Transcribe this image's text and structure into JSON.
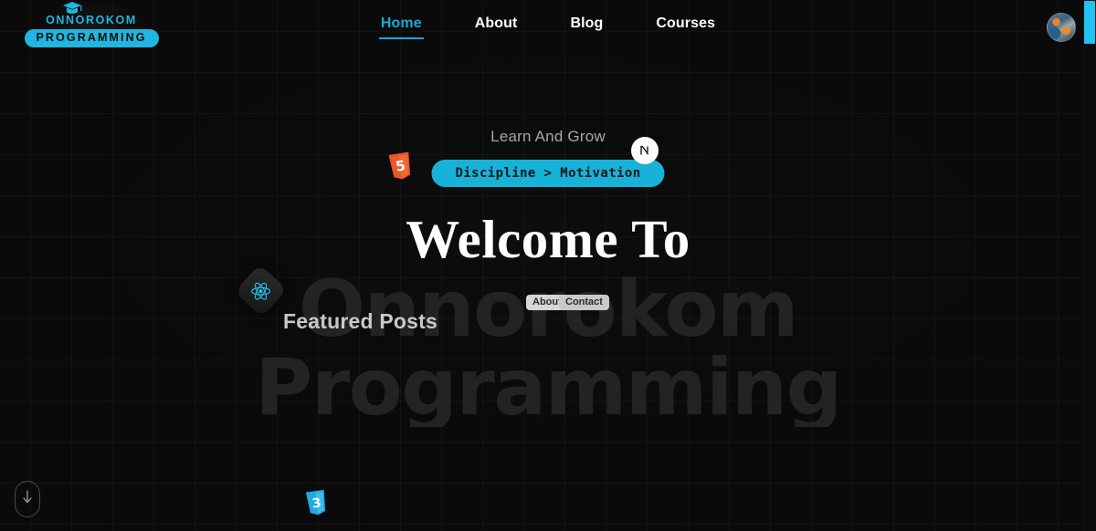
{
  "brand": {
    "icon": "graduation-cap-icon",
    "line1": "ONNOROKOM",
    "line2": "PROGRAMMING",
    "accent": "#20b6e0"
  },
  "nav": {
    "items": [
      {
        "label": "Home",
        "active": true
      },
      {
        "label": "About",
        "active": false
      },
      {
        "label": "Blog",
        "active": false
      },
      {
        "label": "Courses",
        "active": false
      }
    ],
    "active_color": "#17a9d8",
    "inactive_color": "#ffffff"
  },
  "account": {
    "avatar_name": "user-avatar"
  },
  "hero": {
    "eyebrow": "Learn And Grow",
    "tagline_pill": "Discipline > Motivation",
    "tagline_pill_bg": "#18b2d8",
    "welcome": "Welcome To",
    "headline": "Onnorokom Programming",
    "headline_accent": "#12a6d9",
    "headline_dim": "#232323"
  },
  "behind": {
    "featured_posts": "Featured Posts",
    "links": [
      {
        "label": "About"
      },
      {
        "label": "Contact"
      }
    ]
  },
  "floating_logos": [
    {
      "name": "html5-logo",
      "label": "5",
      "color": "#e8582a"
    },
    {
      "name": "react-logo",
      "label": "React",
      "color": "#20c4e8"
    },
    {
      "name": "nextjs-logo",
      "label": "N",
      "color": "#ffffff"
    },
    {
      "name": "css3-logo",
      "label": "3",
      "color": "#23a8e0"
    }
  ],
  "scroll": {
    "indicator_icon": "arrow-down-icon",
    "scrollbar_color": "#1fc2f0"
  }
}
